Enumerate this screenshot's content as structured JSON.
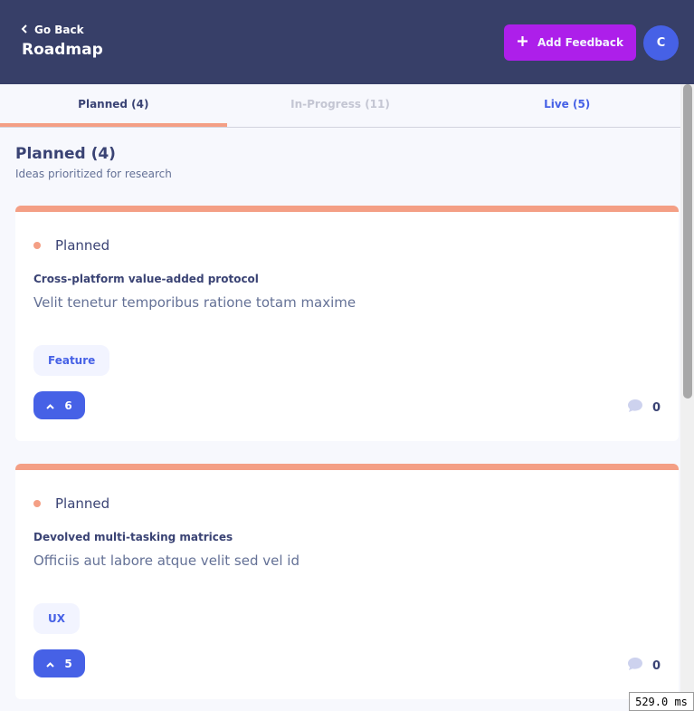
{
  "header": {
    "back_label": "Go Back",
    "title": "Roadmap",
    "add_button_label": "Add Feedback",
    "avatar_initial": "C"
  },
  "tabs": [
    {
      "label": "Planned (4)",
      "active": true
    },
    {
      "label": "In-Progress (11)",
      "active": false
    },
    {
      "label": "Live (5)",
      "active": false
    }
  ],
  "section": {
    "title": "Planned (4)",
    "subtitle": "Ideas prioritized for research"
  },
  "cards": [
    {
      "status": "Planned",
      "title": "Cross-platform value-added protocol",
      "description": "Velit tenetur temporibus ratione totam maxime",
      "tag": "Feature",
      "upvotes": "6",
      "comments": "0"
    },
    {
      "status": "Planned",
      "title": "Devolved multi-tasking matrices",
      "description": "Officiis aut labore atque velit sed vel id",
      "tag": "UX",
      "upvotes": "5",
      "comments": "0"
    }
  ],
  "timing_badge": "529.0 ms",
  "colors": {
    "header_bg": "#373f68",
    "add_button": "#ad1fea",
    "accent_blue": "#4661e6",
    "planned_orange": "#f49f85"
  },
  "icons": {
    "back": "chevron-left-icon",
    "add": "plus-icon",
    "upvote": "chevron-up-icon",
    "comments": "comment-bubble-icon"
  }
}
